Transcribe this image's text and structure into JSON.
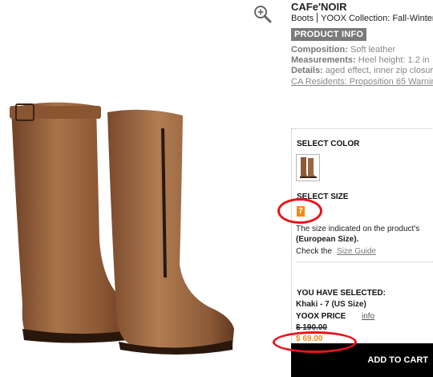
{
  "product": {
    "brand": "CAFe'NOIR",
    "category": "Boots",
    "collection": "YOOX Collection: Fall-Winter",
    "info_tab": "PRODUCT INFO",
    "composition_label": "Composition:",
    "composition_value": "Soft leather",
    "measurements_label": "Measurements:",
    "measurements_value": "Heel height: 1.2 in",
    "details_label": "Details:",
    "details_value": "aged effect, inner zip closur",
    "ca_link": "CA Residents: Proposition 65 Warnin"
  },
  "selection": {
    "color_label": "SELECT COLOR",
    "size_label": "SELECT SIZE",
    "size_value": "7",
    "size_note_1": "The size indicated on the product's",
    "size_note_2": "(European Size).",
    "check_text": "Check the",
    "size_guide": "Size Guide",
    "you_selected_label": "YOU HAVE SELECTED:",
    "selected_value": "Khaki - 7 (US Size)",
    "price_label": "YOOX PRICE",
    "info_link": "info",
    "old_price": "$ 190.00",
    "new_price": "$ 69.00",
    "cart_button": "ADD TO CART"
  },
  "colors": {
    "accent_orange": "#f08a16",
    "annotation_red": "#e8141a",
    "boot_brown": "#8b5a36",
    "cart_bg": "#000000"
  }
}
